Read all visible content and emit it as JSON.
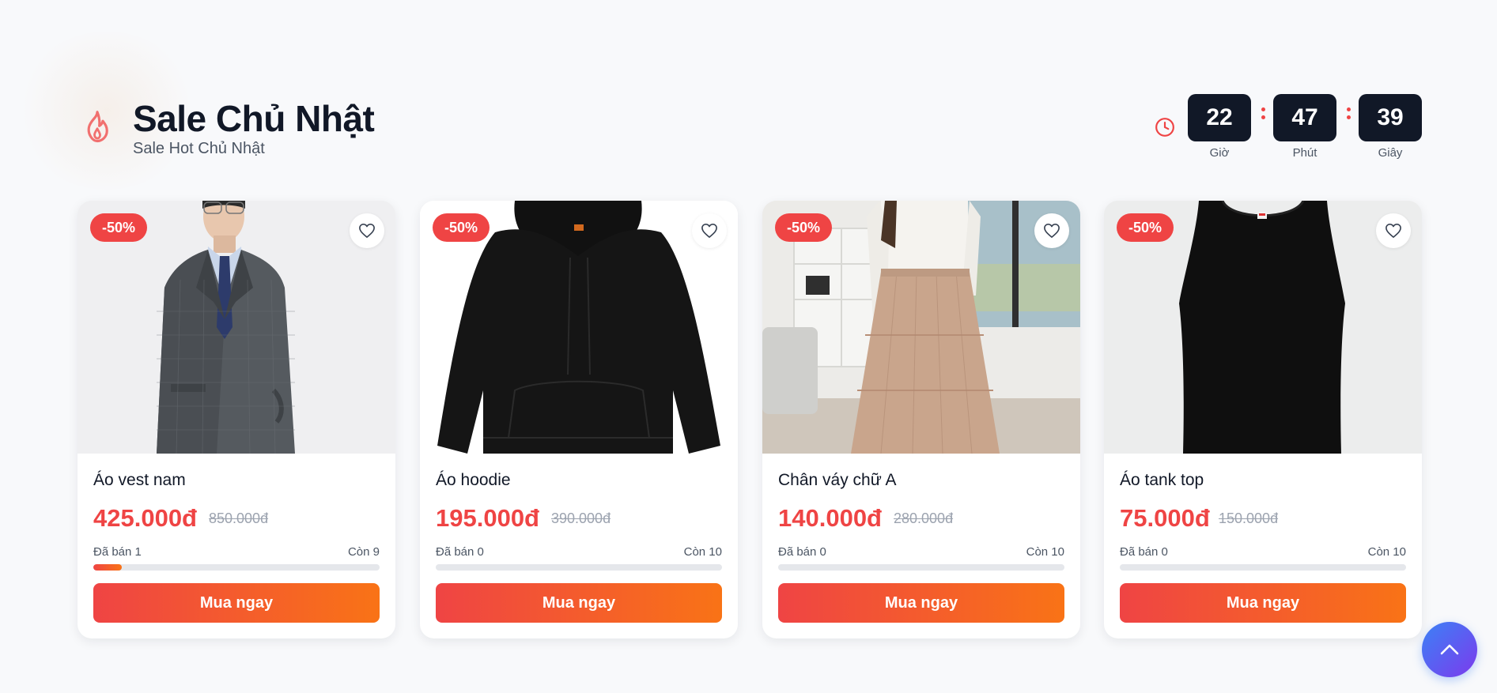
{
  "header": {
    "title": "Sale Chủ Nhật",
    "subtitle": "Sale Hot Chủ Nhật",
    "icon": "fire-icon",
    "accent": "#ef4444"
  },
  "countdown": {
    "icon": "clock-icon",
    "hours": "22",
    "minutes": "47",
    "seconds": "39",
    "hours_label": "Giờ",
    "minutes_label": "Phút",
    "seconds_label": "Giây"
  },
  "products": [
    {
      "name": "Áo vest nam",
      "badge": "-50%",
      "price": "425.000đ",
      "old_price": "850.000đ",
      "sold_text": "Đã bán 1",
      "left_text": "Còn 9",
      "sold_fraction": 0.1,
      "buy_label": "Mua ngay"
    },
    {
      "name": "Áo hoodie",
      "badge": "-50%",
      "price": "195.000đ",
      "old_price": "390.000đ",
      "sold_text": "Đã bán 0",
      "left_text": "Còn 10",
      "sold_fraction": 0,
      "buy_label": "Mua ngay"
    },
    {
      "name": "Chân váy chữ A",
      "badge": "-50%",
      "price": "140.000đ",
      "old_price": "280.000đ",
      "sold_text": "Đã bán 0",
      "left_text": "Còn 10",
      "sold_fraction": 0,
      "buy_label": "Mua ngay"
    },
    {
      "name": "Áo tank top",
      "badge": "-50%",
      "price": "75.000đ",
      "old_price": "150.000đ",
      "sold_text": "Đã bán 0",
      "left_text": "Còn 10",
      "sold_fraction": 0,
      "buy_label": "Mua ngay"
    }
  ],
  "scroll_top": {
    "icon": "chevron-up-icon"
  }
}
